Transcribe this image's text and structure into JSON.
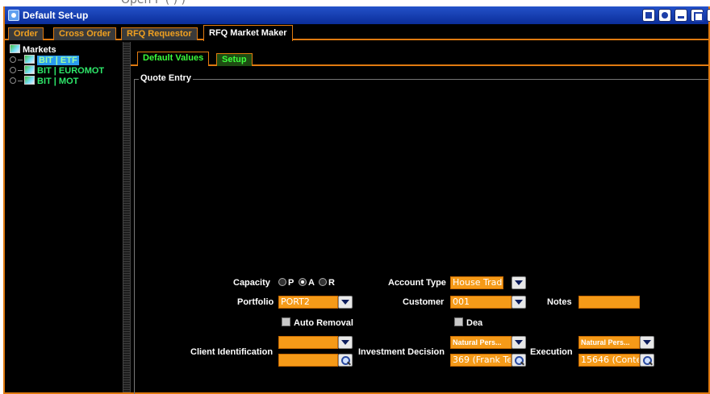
{
  "top_strip_text": "Open         P     (          )   )",
  "window": {
    "title": "Default Set-up"
  },
  "main_tabs": [
    {
      "label": "Order"
    },
    {
      "label": "Cross Order"
    },
    {
      "label": "RFQ Requestor"
    },
    {
      "label": "RFQ Market Maker"
    }
  ],
  "tree": {
    "root": "Markets",
    "items": [
      {
        "label": "BIT | ETF",
        "selected": true
      },
      {
        "label": "BIT | EUROMOT",
        "selected": false
      },
      {
        "label": "BIT | MOT",
        "selected": false
      }
    ]
  },
  "sub_tabs": [
    {
      "label": "Default Values"
    },
    {
      "label": "Setup"
    }
  ],
  "quote_entry": {
    "group_title": "Quote Entry",
    "capacity": {
      "label": "Capacity",
      "options": [
        "P",
        "A",
        "R"
      ],
      "selected": "A"
    },
    "account_type": {
      "label": "Account Type",
      "value": "House Trader"
    },
    "portfolio": {
      "label": "Portfolio",
      "value": "PORT2"
    },
    "customer": {
      "label": "Customer",
      "value": "001"
    },
    "notes": {
      "label": "Notes",
      "value": ""
    },
    "auto_removal": {
      "label": "Auto Removal",
      "checked": false
    },
    "dea": {
      "label": "Dea",
      "checked": false
    },
    "client_identification": {
      "label": "Client Identification",
      "select_value": "",
      "input_value": ""
    },
    "investment_decision": {
      "label": "Investment Decision",
      "select_value": "Natural Pers...",
      "input_value": "369 (Frank Te"
    },
    "execution": {
      "label": "Execution",
      "select_value": "Natural Pers...",
      "input_value": "15646 (Conte"
    }
  },
  "colors": {
    "accent": "#e07a10",
    "field_bg": "#f59a18",
    "tree_green": "#2ee86a",
    "titlebar_blue": "#0a2d9a",
    "background": "#000000"
  }
}
